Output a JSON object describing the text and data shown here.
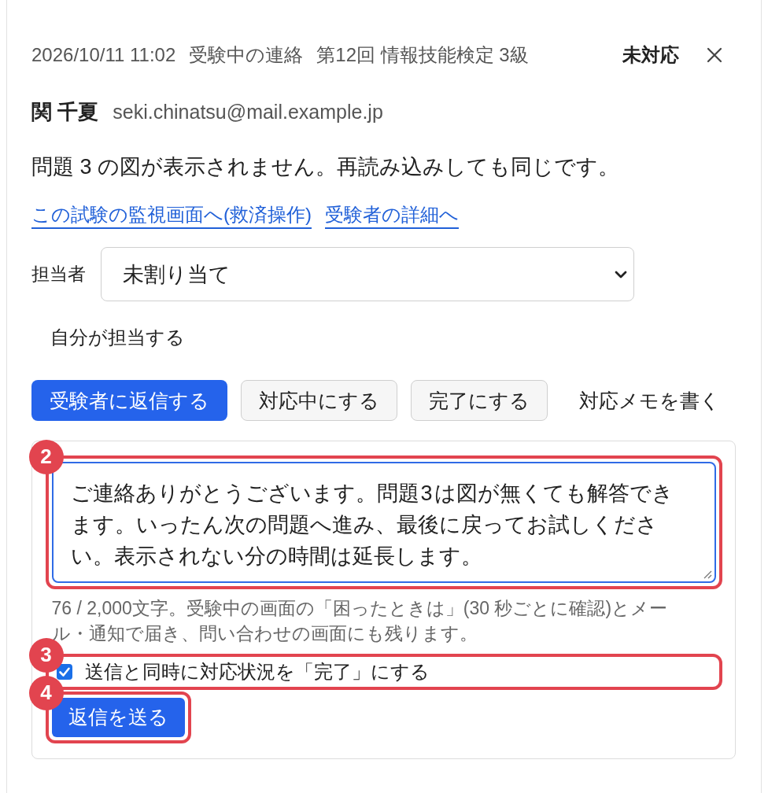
{
  "header": {
    "meta": [
      "2026/10/11 11:02",
      "受験中の連絡",
      "第12回 情報技能検定 3級"
    ],
    "status": "未対応"
  },
  "sender": {
    "name": "関 千夏",
    "email": "seki.chinatsu@mail.example.jp"
  },
  "message": "問題 3 の図が表示されません。再読み込みしても同じです。",
  "links": [
    "この試験の監視画面へ(救済操作)",
    "受験者の詳細へ"
  ],
  "assignee": {
    "label": "担当者",
    "value": "未割り当て",
    "self_assign": "自分が担当する"
  },
  "actions": [
    {
      "label": "受験者に返信する",
      "kind": "primary"
    },
    {
      "label": "対応中にする",
      "kind": "secondary"
    },
    {
      "label": "完了にする",
      "kind": "secondary"
    },
    {
      "label": "対応メモを書く",
      "kind": "text"
    }
  ],
  "reply": {
    "textarea": {
      "value": "ご連絡ありがとうございます。問題 3 は図が無くても解答できます。いったん次の問題へ進み、最後に戻ってお試しください。表示されない分の時間は延長します。",
      "focused": true,
      "annotation": "2"
    },
    "helper": "76 / 2,000文字。受験中の画面の「困ったときは」(30 秒ごとに確認)とメール・通知で届き、問い合わせの画面にも残ります。",
    "complete_on_send": {
      "label": "送信と同時に対応状況を「完了」にする",
      "checked": true,
      "annotation": "3"
    },
    "send": {
      "label": "返信を送る",
      "annotation": "4"
    }
  }
}
